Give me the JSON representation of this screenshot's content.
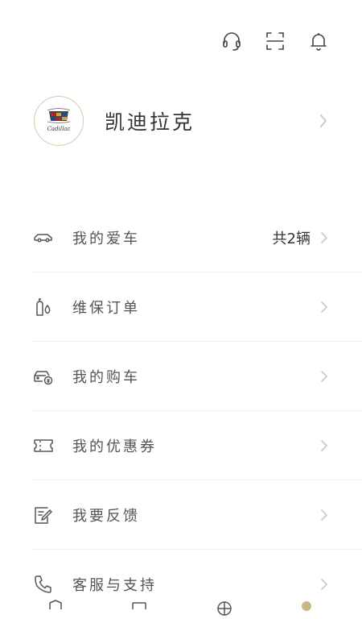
{
  "header": {
    "icons": [
      "headset-icon",
      "scan-icon",
      "bell-icon"
    ]
  },
  "profile": {
    "brand_logo": "cadillac-logo",
    "name": "凯迪拉克"
  },
  "menu": {
    "items": [
      {
        "label": "我的爱车",
        "value": "共2辆",
        "icon": "car-icon"
      },
      {
        "label": "维保订单",
        "icon": "oil-bottle-icon"
      },
      {
        "label": "我的购车",
        "icon": "car-purchase-icon"
      },
      {
        "label": "我的优惠券",
        "icon": "ticket-icon"
      },
      {
        "label": "我要反馈",
        "icon": "edit-icon"
      },
      {
        "label": "客服与支持",
        "icon": "phone-icon"
      }
    ]
  },
  "colors": {
    "accent": "#c8b58a",
    "text": "#333333",
    "icon": "#555555",
    "chevron": "#c7c7c7",
    "divider": "#eeeeee"
  }
}
